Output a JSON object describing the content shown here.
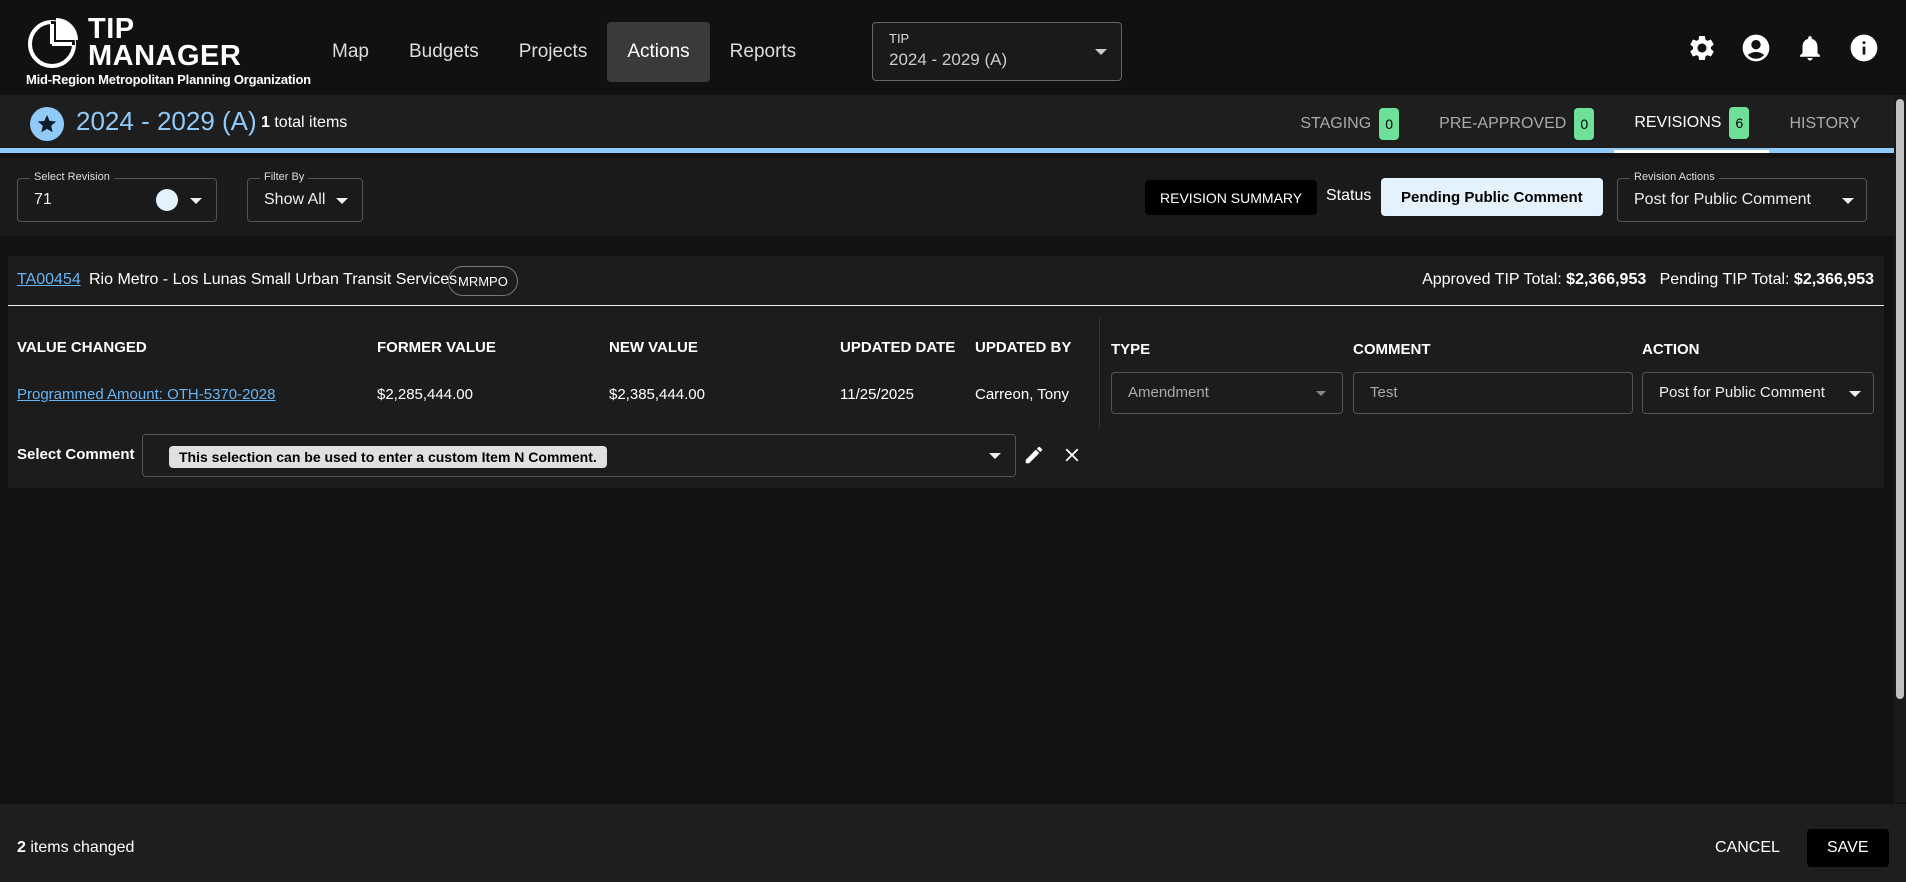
{
  "brand": {
    "title_line1": "TIP",
    "title_line2": "MANAGER",
    "subtitle": "Mid-Region Metropolitan Planning Organization"
  },
  "nav": {
    "items": [
      {
        "label": "Map"
      },
      {
        "label": "Budgets"
      },
      {
        "label": "Projects"
      },
      {
        "label": "Actions"
      },
      {
        "label": "Reports"
      }
    ],
    "active": "Actions"
  },
  "tip_select": {
    "label": "TIP",
    "value": "2024 - 2029 (A)"
  },
  "icons": [
    "gear-icon",
    "account-icon",
    "bell-icon",
    "info-icon"
  ],
  "subheader": {
    "title": "2024 - 2029 (A)",
    "count": "1",
    "count_suffix": "total items",
    "tabs": [
      {
        "label": "STAGING",
        "badge": "0"
      },
      {
        "label": "PRE-APPROVED",
        "badge": "0"
      },
      {
        "label": "REVISIONS",
        "badge": "6"
      },
      {
        "label": "HISTORY",
        "badge": null
      }
    ],
    "active_tab": "REVISIONS",
    "accent_color": "#90caf9"
  },
  "filters": {
    "select_revision": {
      "label": "Select Revision",
      "value": "71"
    },
    "filter_by": {
      "label": "Filter By",
      "value": "Show All"
    },
    "revision_summary_label": "REVISION SUMMARY",
    "status_label": "Status",
    "status_value": "Pending Public Comment",
    "revision_actions": {
      "label": "Revision Actions",
      "value": "Post for Public Comment"
    }
  },
  "project": {
    "id": "TA00454",
    "name": "Rio Metro - Los Lunas Small Urban Transit Services",
    "agency": "MRMPO",
    "approved_label": "Approved TIP Total:",
    "approved_value": "$2,366,953",
    "pending_label": "Pending TIP Total:",
    "pending_value": "$2,366,953"
  },
  "table": {
    "headers": {
      "value_changed": "VALUE CHANGED",
      "former_value": "FORMER VALUE",
      "new_value": "NEW VALUE",
      "updated_date": "UPDATED DATE",
      "updated_by": "UPDATED BY",
      "type": "TYPE",
      "comment": "COMMENT",
      "action": "ACTION"
    },
    "row": {
      "value_changed": "Programmed Amount: OTH-5370-2028",
      "former_value": "$2,285,444.00",
      "new_value": "$2,385,444.00",
      "updated_date": "11/25/2025",
      "updated_by": "Carreon, Tony",
      "type": "Amendment",
      "comment": "Test",
      "action": "Post for Public Comment"
    },
    "select_comment_label": "Select Comment",
    "select_comment_value": "This selection can be used to enter a custom Item N Comment."
  },
  "footer": {
    "count": "2",
    "count_suffix": "items changed",
    "cancel_label": "CANCEL",
    "save_label": "SAVE"
  }
}
